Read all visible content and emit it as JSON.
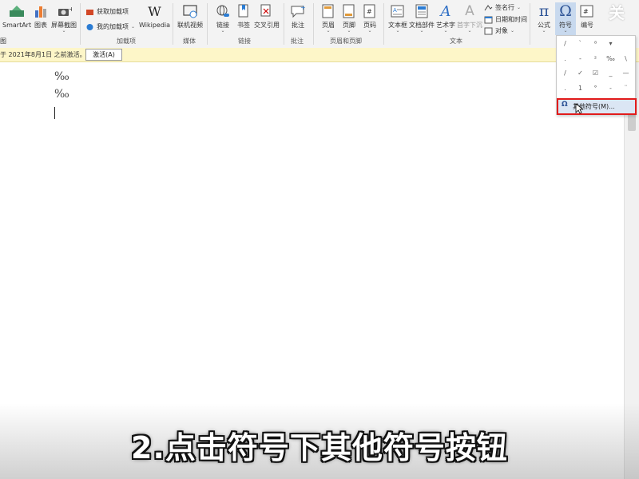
{
  "ribbon": {
    "partial_group_left": "图",
    "tools": {
      "smartart": "SmartArt",
      "chart": "图表",
      "screenshot": "屏幕截图",
      "get_addins": "获取加载项",
      "my_addins": "我的加载项",
      "wikipedia": "Wikipedia",
      "online_video": "联机视频",
      "link": "链接",
      "bookmark": "书签",
      "cross_ref": "交叉引用",
      "comment": "批注",
      "header": "页眉",
      "footer": "页脚",
      "page_number": "页码",
      "textbox": "文本框",
      "quick_parts": "文档部件",
      "wordart": "艺术字",
      "dropcap": "首字下沉",
      "signature_line": "签名行",
      "date_time": "日期和时间",
      "object": "对象",
      "equation": "公式",
      "symbol": "符号",
      "numbering": "编号"
    },
    "groups": {
      "addins": "加载项",
      "media": "媒体",
      "links": "链接",
      "comments": "批注",
      "header_footer": "页眉和页脚",
      "text": "文本"
    }
  },
  "notice": {
    "text": "于 2021年8月1日 之前激活。",
    "button": "激活(A)"
  },
  "document": {
    "line1": "‰",
    "line2": "‰"
  },
  "symbol_menu": {
    "symbols": [
      "/",
      "`",
      "⁸",
      "▾",
      ".",
      "-",
      "²",
      "‰",
      "\\",
      "/",
      "✓",
      "☑",
      "_",
      "—",
      ".",
      "1",
      "°",
      "-",
      "¨"
    ],
    "more_symbols": "其他符号(M)..."
  },
  "subtitle": "2.点击符号下其他符号按钮",
  "watermark": "关"
}
